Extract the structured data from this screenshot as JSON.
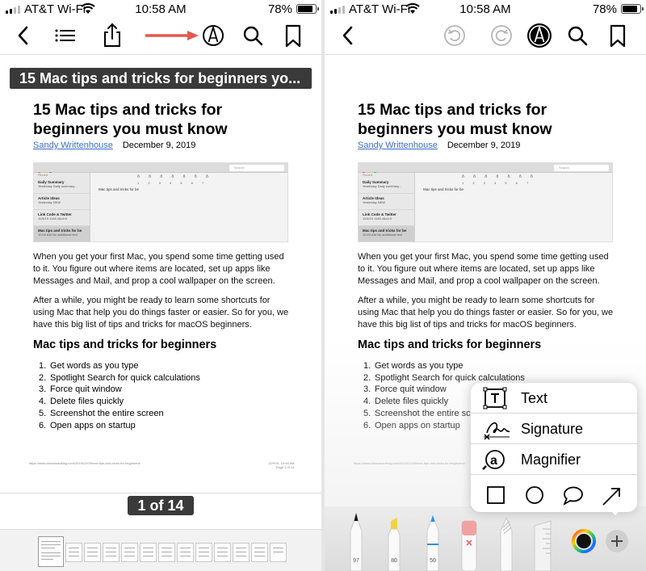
{
  "status": {
    "carrier": "AT&T Wi-Fi",
    "time": "10:58 AM",
    "battery": "78%",
    "battery_level": 0.78
  },
  "article": {
    "title": "15 Mac tips and tricks for beginners you must know",
    "author": "Sandy Writtenhouse",
    "date": "December 9, 2019",
    "para1": "When you get your first Mac, you spend some time getting used to it. You figure out where items are located, set up apps like Messages and Mail, and prop a cool wallpaper on the screen.",
    "para2": "After a while, you might be ready to learn some shortcuts for using Mac that help you do things faster or easier. So for you, we have this big list of tips and tricks for macOS beginners.",
    "subheading": "Mac tips and tricks for beginners",
    "list": [
      {
        "n": "1.",
        "text": "Get words as you type"
      },
      {
        "n": "2.",
        "text": "Spotlight Search for quick calculations"
      },
      {
        "n": "3.",
        "text": "Force quit window"
      },
      {
        "n": "4.",
        "text": "Delete files quickly"
      },
      {
        "n": "5.",
        "text": "Screenshot the entire screen"
      },
      {
        "n": "6.",
        "text": "Open apps on startup"
      }
    ],
    "footer_url": "https://www.idownloadblog.com/2019/12/09/mac-tips-and-tricks-for-beginners/",
    "footer_date": "12/9/19, 10:49 AM",
    "footer_page": "Page 1 of 14"
  },
  "screenshot": {
    "pinned": "Pinned",
    "search": "Search",
    "notes": [
      {
        "title": "Daily Summary",
        "sub": "Yesterday  Daily summary..."
      },
      {
        "title": "Article Ideas",
        "sub": "Yesterday  NEW"
      },
      {
        "title": "Link Code & Twitter",
        "sub": "11/5/19  1145.4&cl=0"
      },
      {
        "title": "Mac tips and tricks for be",
        "sub": "10:04 AM  No additional text"
      }
    ],
    "note_body": "Mac tips and tricks for be",
    "letters": "ǒ ǒ ǒ ǒ ǒ ǒ ǒ",
    "numbers": "1 2 3 4 5 6 7"
  },
  "left": {
    "title_banner": "15 Mac tips and tricks for beginners yo...",
    "page_indicator": "1 of 14",
    "icons": [
      "back-chevron-icon",
      "list-icon",
      "share-icon",
      "markup-icon",
      "search-icon",
      "bookmark-icon"
    ]
  },
  "right": {
    "icons": [
      "back-chevron-icon",
      "undo-icon",
      "redo-icon",
      "markup-icon-active",
      "search-icon",
      "bookmark-icon"
    ],
    "menu": {
      "items": [
        {
          "label": "Text",
          "icon": "text-box-icon"
        },
        {
          "label": "Signature",
          "icon": "signature-icon"
        },
        {
          "label": "Magnifier",
          "icon": "magnifier-icon"
        }
      ],
      "shapes": [
        "square-icon",
        "circle-icon",
        "speech-bubble-icon",
        "arrow-icon"
      ]
    },
    "tools": [
      {
        "name": "pen",
        "value": "97"
      },
      {
        "name": "highlighter",
        "value": "80"
      },
      {
        "name": "pencil",
        "value": "50"
      },
      {
        "name": "eraser",
        "value": ""
      },
      {
        "name": "lasso",
        "value": ""
      },
      {
        "name": "ruler",
        "value": ""
      }
    ]
  },
  "colors": {
    "accent": "#3a6fc4",
    "arrow": "#e05a4e",
    "banner": "#3a3a3a"
  }
}
